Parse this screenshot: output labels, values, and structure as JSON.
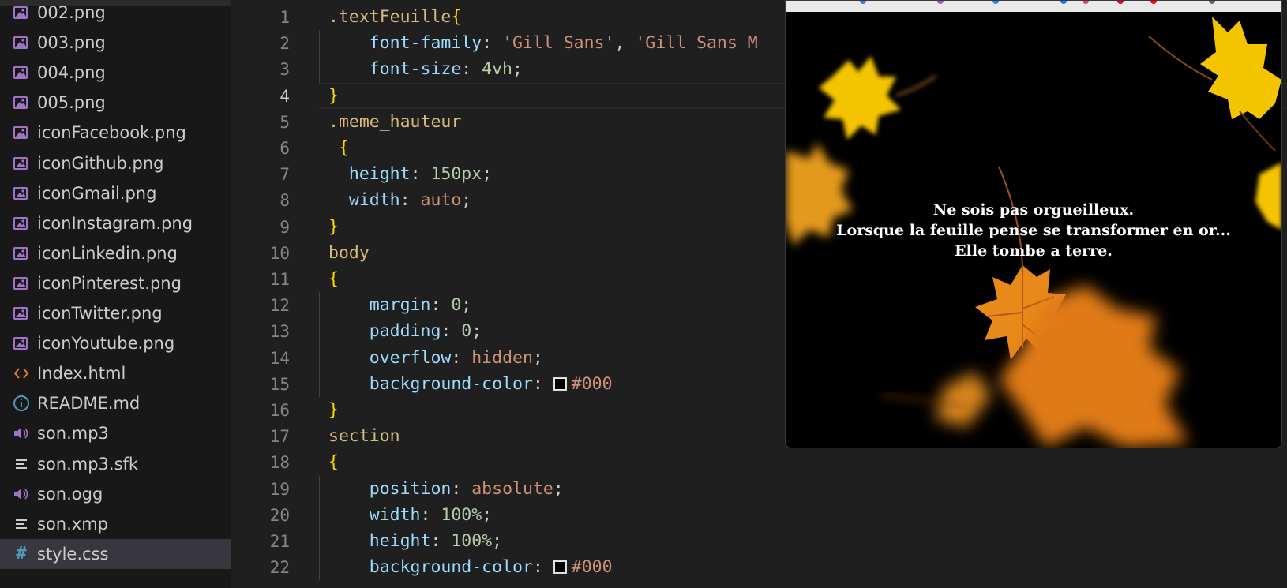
{
  "explorer": {
    "files": [
      {
        "name": "002.png",
        "icon": "image-icon"
      },
      {
        "name": "003.png",
        "icon": "image-icon"
      },
      {
        "name": "004.png",
        "icon": "image-icon"
      },
      {
        "name": "005.png",
        "icon": "image-icon"
      },
      {
        "name": "iconFacebook.png",
        "icon": "image-icon"
      },
      {
        "name": "iconGithub.png",
        "icon": "image-icon"
      },
      {
        "name": "iconGmail.png",
        "icon": "image-icon"
      },
      {
        "name": "iconInstagram.png",
        "icon": "image-icon"
      },
      {
        "name": "iconLinkedin.png",
        "icon": "image-icon"
      },
      {
        "name": "iconPinterest.png",
        "icon": "image-icon"
      },
      {
        "name": "iconTwitter.png",
        "icon": "image-icon"
      },
      {
        "name": "iconYoutube.png",
        "icon": "image-icon"
      },
      {
        "name": "Index.html",
        "icon": "html-code-icon"
      },
      {
        "name": "README.md",
        "icon": "info-icon"
      },
      {
        "name": "son.mp3",
        "icon": "audio-icon"
      },
      {
        "name": "son.mp3.sfk",
        "icon": "text-lines-icon"
      },
      {
        "name": "son.ogg",
        "icon": "audio-icon"
      },
      {
        "name": "son.xmp",
        "icon": "text-lines-icon"
      },
      {
        "name": "style.css",
        "icon": "hash-icon",
        "active": true
      }
    ]
  },
  "editor": {
    "current_line": 4,
    "lines": [
      {
        "n": "1",
        "tokens": [
          {
            "t": ".textFeuille",
            "c": "sel"
          },
          {
            "t": "{",
            "c": "brace"
          }
        ]
      },
      {
        "n": "2",
        "tokens": [
          {
            "t": "    font-family",
            "c": "prop"
          },
          {
            "t": ": ",
            "c": "punct"
          },
          {
            "t": "'Gill Sans'",
            "c": "str"
          },
          {
            "t": ", ",
            "c": "punct"
          },
          {
            "t": "'Gill Sans M",
            "c": "str"
          }
        ]
      },
      {
        "n": "3",
        "tokens": [
          {
            "t": "    font-size",
            "c": "prop"
          },
          {
            "t": ": ",
            "c": "punct"
          },
          {
            "t": "4vh",
            "c": "num"
          },
          {
            "t": ";",
            "c": "punct"
          }
        ]
      },
      {
        "n": "4",
        "tokens": [
          {
            "t": "}",
            "c": "brace"
          }
        ]
      },
      {
        "n": "5",
        "tokens": [
          {
            "t": ".meme_hauteur",
            "c": "sel"
          }
        ]
      },
      {
        "n": "6",
        "tokens": [
          {
            "t": " {",
            "c": "brace"
          }
        ]
      },
      {
        "n": "7",
        "tokens": [
          {
            "t": "  height",
            "c": "prop"
          },
          {
            "t": ": ",
            "c": "punct"
          },
          {
            "t": "150px",
            "c": "num"
          },
          {
            "t": ";",
            "c": "punct"
          }
        ]
      },
      {
        "n": "8",
        "tokens": [
          {
            "t": "  width",
            "c": "prop"
          },
          {
            "t": ": ",
            "c": "punct"
          },
          {
            "t": "auto",
            "c": "kw"
          },
          {
            "t": ";",
            "c": "punct"
          }
        ]
      },
      {
        "n": "9",
        "tokens": [
          {
            "t": "}",
            "c": "brace"
          }
        ]
      },
      {
        "n": "10",
        "tokens": [
          {
            "t": "body",
            "c": "sel"
          }
        ]
      },
      {
        "n": "11",
        "tokens": [
          {
            "t": "{",
            "c": "brace"
          }
        ]
      },
      {
        "n": "12",
        "tokens": [
          {
            "t": "    margin",
            "c": "prop"
          },
          {
            "t": ": ",
            "c": "punct"
          },
          {
            "t": "0",
            "c": "num"
          },
          {
            "t": ";",
            "c": "punct"
          }
        ]
      },
      {
        "n": "13",
        "tokens": [
          {
            "t": "    padding",
            "c": "prop"
          },
          {
            "t": ": ",
            "c": "punct"
          },
          {
            "t": "0",
            "c": "num"
          },
          {
            "t": ";",
            "c": "punct"
          }
        ]
      },
      {
        "n": "14",
        "tokens": [
          {
            "t": "    overflow",
            "c": "prop"
          },
          {
            "t": ": ",
            "c": "punct"
          },
          {
            "t": "hidden",
            "c": "kw"
          },
          {
            "t": ";",
            "c": "punct"
          }
        ]
      },
      {
        "n": "15",
        "tokens": [
          {
            "t": "    background-color",
            "c": "prop"
          },
          {
            "t": ": ",
            "c": "punct"
          },
          {
            "t": "",
            "c": "swatch"
          },
          {
            "t": "#000",
            "c": "str"
          }
        ]
      },
      {
        "n": "16",
        "tokens": [
          {
            "t": "}",
            "c": "brace"
          }
        ]
      },
      {
        "n": "17",
        "tokens": [
          {
            "t": "section",
            "c": "sel"
          }
        ]
      },
      {
        "n": "18",
        "tokens": [
          {
            "t": "{",
            "c": "brace"
          }
        ]
      },
      {
        "n": "19",
        "tokens": [
          {
            "t": "    position",
            "c": "prop"
          },
          {
            "t": ": ",
            "c": "punct"
          },
          {
            "t": "absolute",
            "c": "kw"
          },
          {
            "t": ";",
            "c": "punct"
          }
        ]
      },
      {
        "n": "20",
        "tokens": [
          {
            "t": "    width",
            "c": "prop"
          },
          {
            "t": ": ",
            "c": "punct"
          },
          {
            "t": "100%",
            "c": "num"
          },
          {
            "t": ";",
            "c": "punct"
          }
        ]
      },
      {
        "n": "21",
        "tokens": [
          {
            "t": "    height",
            "c": "prop"
          },
          {
            "t": ": ",
            "c": "punct"
          },
          {
            "t": "100%",
            "c": "num"
          },
          {
            "t": ";",
            "c": "punct"
          }
        ]
      },
      {
        "n": "22",
        "tokens": [
          {
            "t": "    background-color",
            "c": "prop"
          },
          {
            "t": ": ",
            "c": "punct"
          },
          {
            "t": "",
            "c": "swatch"
          },
          {
            "t": "#000",
            "c": "str"
          }
        ]
      }
    ]
  },
  "preview": {
    "quote": {
      "line1": "Ne sois pas orgueilleux.",
      "line2": "Lorsque la feuille pense se transformer en or...",
      "line3": "Elle tombe a terre."
    }
  },
  "colors": {
    "selector": "#d7ba7d",
    "property": "#9cdcfe",
    "string": "#ce9178",
    "number": "#b5cea8",
    "brace": "#ffd700",
    "editor_bg": "#1f1f1f",
    "sidebar_bg": "#181818",
    "active_row": "#37373d",
    "image_icon": "#a074c4",
    "html_icon": "#e37933",
    "info_icon": "#519aba",
    "leaf_gold": "#f5c400",
    "leaf_orange": "#e8891a"
  }
}
